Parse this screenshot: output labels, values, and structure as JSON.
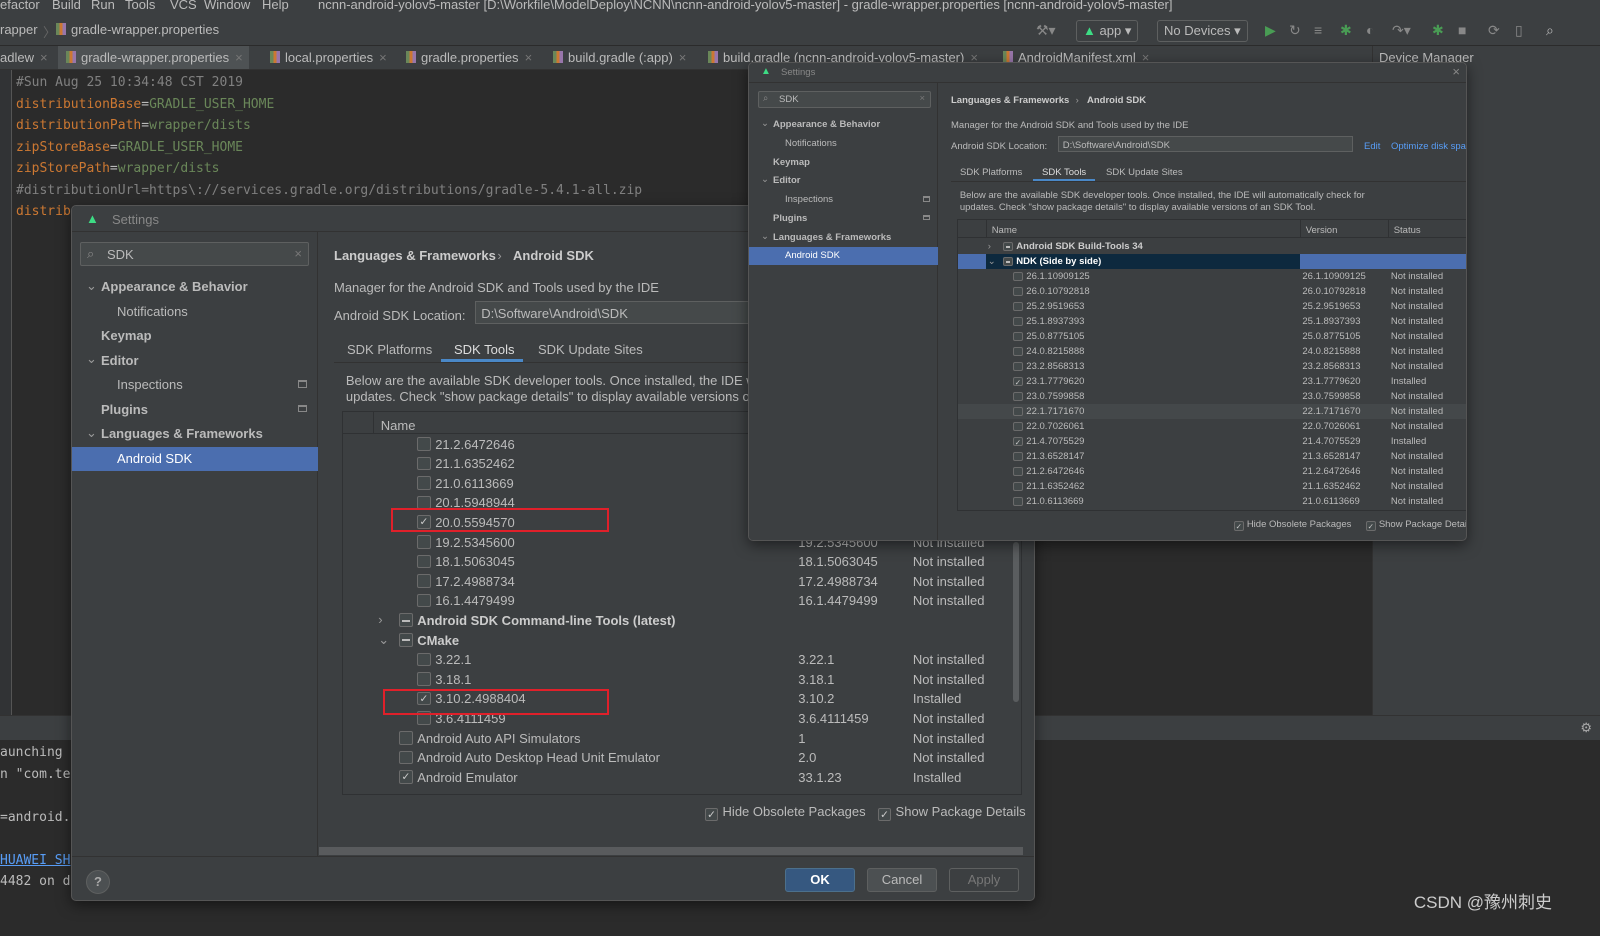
{
  "menu": {
    "items": [
      "efactor",
      "Build",
      "Run",
      "Tools",
      "VCS",
      "Window",
      "Help"
    ],
    "window_title": "ncnn-android-yolov5-master [D:\\Workfile\\ModelDeploy\\NCNN\\ncnn-android-yolov5-master] - gradle-wrapper.properties [ncnn-android-yolov5-master]"
  },
  "toolbar": {
    "breadcrumb": [
      "rapper",
      "gradle-wrapper.properties"
    ],
    "run_config": "app",
    "device": "No Devices"
  },
  "tabs": [
    {
      "label": "adlew"
    },
    {
      "label": "gradle-wrapper.properties",
      "active": true
    },
    {
      "label": "local.properties"
    },
    {
      "label": "gradle.properties"
    },
    {
      "label": "build.gradle (:app)"
    },
    {
      "label": "build.gradle (ncnn-android-yolov5-master)"
    },
    {
      "label": "AndroidManifest.xml"
    }
  ],
  "device_manager_label": "Device Manager",
  "editor": {
    "lines": [
      {
        "comment": "#Sun Aug 25 10:34:48 CST 2019"
      },
      {
        "key": "distributionBase",
        "value": "GRADLE_USER_HOME"
      },
      {
        "key": "distributionPath",
        "value": "wrapper/dists"
      },
      {
        "key": "zipStoreBase",
        "value": "GRADLE_USER_HOME"
      },
      {
        "key": "zipStorePath",
        "value": "wrapper/dists"
      },
      {
        "comment": "#distributionUrl=https\\://services.gradle.org/distributions/gradle-5.4.1-all.zip"
      },
      {
        "key": "distrib",
        "value": ""
      }
    ]
  },
  "console": {
    "lines": [
      "aunching",
      "n \"com.te",
      "",
      "=android.",
      "",
      "HUAWEI SH",
      "4482 on d"
    ],
    "link_line": 5
  },
  "settings_large": {
    "title": "Settings",
    "search": "SDK",
    "tree": [
      {
        "label": "Appearance & Behavior",
        "bold": true,
        "expanded": true,
        "level": 0
      },
      {
        "label": "Notifications",
        "level": 1
      },
      {
        "label": "Keymap",
        "bold": true,
        "level": 0
      },
      {
        "label": "Editor",
        "bold": true,
        "expanded": true,
        "level": 0
      },
      {
        "label": "Inspections",
        "level": 1,
        "badge": true
      },
      {
        "label": "Plugins",
        "bold": true,
        "level": 0,
        "badge": true
      },
      {
        "label": "Languages & Frameworks",
        "bold": true,
        "expanded": true,
        "level": 0
      },
      {
        "label": "Android SDK",
        "level": 1,
        "selected": true
      }
    ],
    "breadcrumb": [
      "Languages & Frameworks",
      "Android SDK"
    ],
    "description": "Manager for the Android SDK and Tools used by the IDE",
    "location_label": "Android SDK Location:",
    "location_value": "D:\\Software\\Android\\SDK",
    "tabs": [
      "SDK Platforms",
      "SDK Tools",
      "SDK Update Sites"
    ],
    "active_tab": 1,
    "info": [
      "Below are the available SDK developer tools. Once installed, the IDE w",
      "updates. Check \"show package details\" to display available versions o"
    ],
    "columns": [
      "Name",
      "Version",
      "Status"
    ],
    "rows": [
      {
        "name": "21.2.6472646",
        "level": 2,
        "checked": false
      },
      {
        "name": "21.1.6352462",
        "level": 2,
        "checked": false
      },
      {
        "name": "21.0.6113669",
        "level": 2,
        "checked": false
      },
      {
        "name": "20.1.5948944",
        "level": 2,
        "checked": false
      },
      {
        "name": "20.0.5594570",
        "level": 2,
        "checked": true,
        "highlight": true
      },
      {
        "name": "19.2.5345600",
        "version": "19.2.5345600",
        "status": "Not installed",
        "level": 2,
        "checked": false
      },
      {
        "name": "18.1.5063045",
        "version": "18.1.5063045",
        "status": "Not installed",
        "level": 2,
        "checked": false
      },
      {
        "name": "17.2.4988734",
        "version": "17.2.4988734",
        "status": "Not installed",
        "level": 2,
        "checked": false
      },
      {
        "name": "16.1.4479499",
        "version": "16.1.4479499",
        "status": "Not installed",
        "level": 2,
        "checked": false
      },
      {
        "name": "Android SDK Command-line Tools (latest)",
        "level": 1,
        "group": true,
        "expanded": false
      },
      {
        "name": "CMake",
        "level": 1,
        "group": true,
        "expanded": true
      },
      {
        "name": "3.22.1",
        "version": "3.22.1",
        "status": "Not installed",
        "level": 2,
        "checked": false
      },
      {
        "name": "3.18.1",
        "version": "3.18.1",
        "status": "Not installed",
        "level": 2,
        "checked": false
      },
      {
        "name": "3.10.2.4988404",
        "version": "3.10.2",
        "status": "Installed",
        "level": 2,
        "checked": true,
        "highlight": true
      },
      {
        "name": "3.6.4111459",
        "version": "3.6.4111459",
        "status": "Not installed",
        "level": 2,
        "checked": false
      },
      {
        "name": "Android Auto API Simulators",
        "version": "1",
        "status": "Not installed",
        "level": 1,
        "checked": false
      },
      {
        "name": "Android Auto Desktop Head Unit Emulator",
        "version": "2.0",
        "status": "Not installed",
        "level": 1,
        "checked": false
      },
      {
        "name": "Android Emulator",
        "version": "33.1.23",
        "status": "Installed",
        "level": 1,
        "checked": true
      }
    ],
    "hide_obsolete": {
      "label": "Hide Obsolete Packages",
      "checked": true
    },
    "show_details": {
      "label": "Show Package Details",
      "checked": true
    },
    "buttons": {
      "help": "?",
      "ok": "OK",
      "cancel": "Cancel",
      "apply": "Apply"
    }
  },
  "settings_small": {
    "title": "Settings",
    "search": "SDK",
    "tree": [
      {
        "label": "Appearance & Behavior",
        "bold": true,
        "expanded": true,
        "level": 0
      },
      {
        "label": "Notifications",
        "level": 1
      },
      {
        "label": "Keymap",
        "bold": true,
        "level": 0
      },
      {
        "label": "Editor",
        "bold": true,
        "expanded": true,
        "level": 0
      },
      {
        "label": "Inspections",
        "level": 1,
        "badge": true
      },
      {
        "label": "Plugins",
        "bold": true,
        "level": 0,
        "badge": true
      },
      {
        "label": "Languages & Frameworks",
        "bold": true,
        "expanded": true,
        "level": 0
      },
      {
        "label": "Android SDK",
        "level": 1,
        "selected": true
      }
    ],
    "breadcrumb": [
      "Languages & Frameworks",
      "Android SDK"
    ],
    "description": "Manager for the Android SDK and Tools used by the IDE",
    "location_label": "Android SDK Location:",
    "location_value": "D:\\Software\\Android\\SDK",
    "edit_link": "Edit",
    "optimize_link": "Optimize disk space",
    "tabs": [
      "SDK Platforms",
      "SDK Tools",
      "SDK Update Sites"
    ],
    "active_tab": 1,
    "info": [
      "Below are the available SDK developer tools. Once installed, the IDE will automatically check for",
      "updates. Check \"show package details\" to display available versions of an SDK Tool."
    ],
    "columns": [
      "Name",
      "Version",
      "Status"
    ],
    "rows": [
      {
        "name": "Android SDK Build-Tools 34",
        "level": 1,
        "group": true,
        "expanded": false
      },
      {
        "name": "NDK (Side by side)",
        "level": 1,
        "group": true,
        "expanded": true,
        "selected": true
      },
      {
        "name": "26.1.10909125",
        "version": "26.1.10909125",
        "status": "Not installed",
        "level": 2,
        "checked": false
      },
      {
        "name": "26.0.10792818",
        "version": "26.0.10792818",
        "status": "Not installed",
        "level": 2,
        "checked": false
      },
      {
        "name": "25.2.9519653",
        "version": "25.2.9519653",
        "status": "Not installed",
        "level": 2,
        "checked": false
      },
      {
        "name": "25.1.8937393",
        "version": "25.1.8937393",
        "status": "Not installed",
        "level": 2,
        "checked": false
      },
      {
        "name": "25.0.8775105",
        "version": "25.0.8775105",
        "status": "Not installed",
        "level": 2,
        "checked": false
      },
      {
        "name": "24.0.8215888",
        "version": "24.0.8215888",
        "status": "Not installed",
        "level": 2,
        "checked": false
      },
      {
        "name": "23.2.8568313",
        "version": "23.2.8568313",
        "status": "Not installed",
        "level": 2,
        "checked": false
      },
      {
        "name": "23.1.7779620",
        "version": "23.1.7779620",
        "status": "Installed",
        "level": 2,
        "checked": true
      },
      {
        "name": "23.0.7599858",
        "version": "23.0.7599858",
        "status": "Not installed",
        "level": 2,
        "checked": false
      },
      {
        "name": "22.1.7171670",
        "version": "22.1.7171670",
        "status": "Not installed",
        "level": 2,
        "checked": false,
        "hover": true
      },
      {
        "name": "22.0.7026061",
        "version": "22.0.7026061",
        "status": "Not installed",
        "level": 2,
        "checked": false
      },
      {
        "name": "21.4.7075529",
        "version": "21.4.7075529",
        "status": "Installed",
        "level": 2,
        "checked": true
      },
      {
        "name": "21.3.6528147",
        "version": "21.3.6528147",
        "status": "Not installed",
        "level": 2,
        "checked": false
      },
      {
        "name": "21.2.6472646",
        "version": "21.2.6472646",
        "status": "Not installed",
        "level": 2,
        "checked": false
      },
      {
        "name": "21.1.6352462",
        "version": "21.1.6352462",
        "status": "Not installed",
        "level": 2,
        "checked": false
      },
      {
        "name": "21.0.6113669",
        "version": "21.0.6113669",
        "status": "Not installed",
        "level": 2,
        "checked": false
      }
    ],
    "hide_obsolete": {
      "label": "Hide Obsolete Packages",
      "checked": true
    },
    "show_details": {
      "label": "Show Package Details",
      "checked": true
    }
  },
  "watermark": "CSDN @豫州刺史",
  "colors": {
    "accent": "#4b6eaf",
    "selection_dark": "#0d293e",
    "link": "#589df6",
    "highlight_box": "#e0202a",
    "ok_button": "#365880"
  }
}
